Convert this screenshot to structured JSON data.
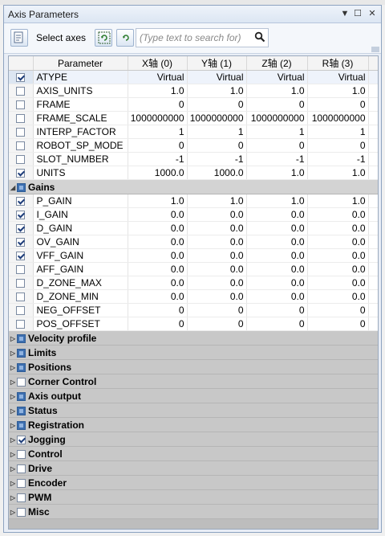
{
  "window": {
    "title": "Axis Parameters"
  },
  "toolbar": {
    "select_axes_label": "Select axes",
    "search_placeholder": "(Type text to search for)"
  },
  "columns": [
    "Parameter",
    "X轴 (0)",
    "Y轴 (1)",
    "Z轴 (2)",
    "R轴 (3)"
  ],
  "general_rows": [
    {
      "checked": true,
      "name": "ATYPE",
      "values": [
        "Virtual",
        "Virtual",
        "Virtual",
        "Virtual"
      ],
      "selected": true
    },
    {
      "checked": false,
      "name": "AXIS_UNITS",
      "values": [
        "1.0",
        "1.0",
        "1.0",
        "1.0"
      ]
    },
    {
      "checked": false,
      "name": "FRAME",
      "values": [
        "0",
        "0",
        "0",
        "0"
      ]
    },
    {
      "checked": false,
      "name": "FRAME_SCALE",
      "values": [
        "1000000000",
        "1000000000",
        "1000000000",
        "1000000000"
      ]
    },
    {
      "checked": false,
      "name": "INTERP_FACTOR",
      "values": [
        "1",
        "1",
        "1",
        "1"
      ]
    },
    {
      "checked": false,
      "name": "ROBOT_SP_MODE",
      "values": [
        "0",
        "0",
        "0",
        "0"
      ]
    },
    {
      "checked": false,
      "name": "SLOT_NUMBER",
      "values": [
        "-1",
        "-1",
        "-1",
        "-1"
      ]
    },
    {
      "checked": true,
      "name": "UNITS",
      "values": [
        "1000.0",
        "1000.0",
        "1.0",
        "1.0"
      ]
    }
  ],
  "gains_group": {
    "label": "Gains",
    "expanded": true
  },
  "gains_rows": [
    {
      "checked": true,
      "name": "P_GAIN",
      "values": [
        "1.0",
        "1.0",
        "1.0",
        "1.0"
      ]
    },
    {
      "checked": true,
      "name": "I_GAIN",
      "values": [
        "0.0",
        "0.0",
        "0.0",
        "0.0"
      ]
    },
    {
      "checked": true,
      "name": "D_GAIN",
      "values": [
        "0.0",
        "0.0",
        "0.0",
        "0.0"
      ]
    },
    {
      "checked": true,
      "name": "OV_GAIN",
      "values": [
        "0.0",
        "0.0",
        "0.0",
        "0.0"
      ]
    },
    {
      "checked": true,
      "name": "VFF_GAIN",
      "values": [
        "0.0",
        "0.0",
        "0.0",
        "0.0"
      ]
    },
    {
      "checked": false,
      "name": "AFF_GAIN",
      "values": [
        "0.0",
        "0.0",
        "0.0",
        "0.0"
      ]
    },
    {
      "checked": false,
      "name": "D_ZONE_MAX",
      "values": [
        "0.0",
        "0.0",
        "0.0",
        "0.0"
      ]
    },
    {
      "checked": false,
      "name": "D_ZONE_MIN",
      "values": [
        "0.0",
        "0.0",
        "0.0",
        "0.0"
      ]
    },
    {
      "checked": false,
      "name": "NEG_OFFSET",
      "values": [
        "0",
        "0",
        "0",
        "0"
      ]
    },
    {
      "checked": false,
      "name": "POS_OFFSET",
      "values": [
        "0",
        "0",
        "0",
        "0"
      ]
    }
  ],
  "collapsed_groups": [
    {
      "label": "Velocity profile",
      "state": "partial"
    },
    {
      "label": "Limits",
      "state": "partial"
    },
    {
      "label": "Positions",
      "state": "partial"
    },
    {
      "label": "Corner Control",
      "state": "none"
    },
    {
      "label": "Axis output",
      "state": "partial"
    },
    {
      "label": "Status",
      "state": "partial"
    },
    {
      "label": "Registration",
      "state": "partial"
    },
    {
      "label": "Jogging",
      "state": "checked"
    },
    {
      "label": "Control",
      "state": "none"
    },
    {
      "label": "Drive",
      "state": "none"
    },
    {
      "label": "Encoder",
      "state": "none"
    },
    {
      "label": "PWM",
      "state": "none"
    },
    {
      "label": "Misc",
      "state": "none"
    }
  ]
}
